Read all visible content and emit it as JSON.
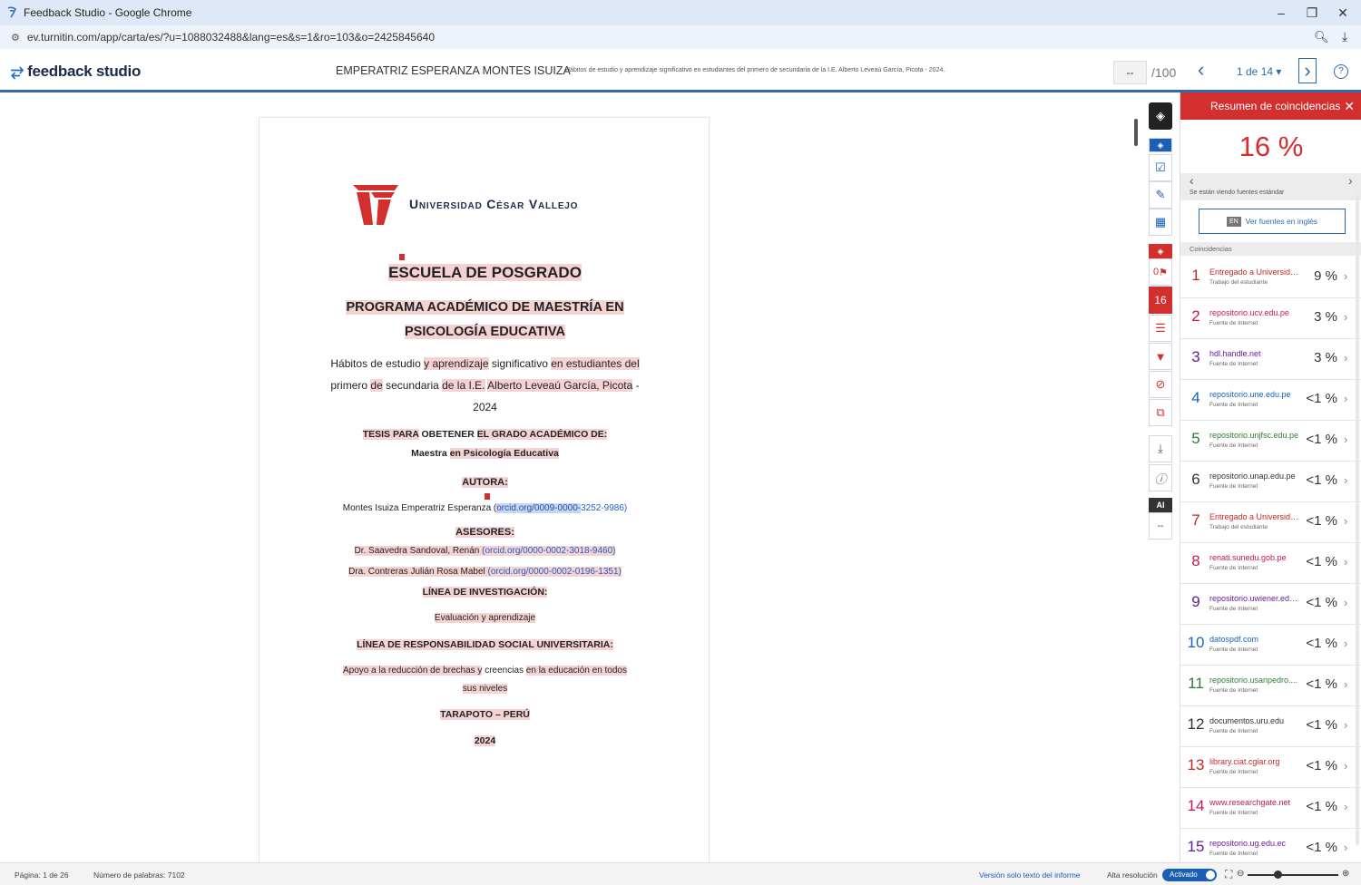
{
  "browser": {
    "window_title": "Feedback Studio - Google Chrome",
    "url": "ev.turnitin.com/app/carta/es/?u=1088032488&lang=es&s=1&ro=103&o=2425845640"
  },
  "header": {
    "brand": "feedback studio",
    "author": "EMPERATRIZ ESPERANZA MONTES ISUIZA",
    "title": "Hábitos de estudio y aprendizaje significativo en estudiantes del primero de secundaria de la I.E. Alberto Leveaú García, Picota - 2024.",
    "score": "--",
    "score_max": "/100",
    "page_indicator": "1 de 14 ▾"
  },
  "document": {
    "university": "Universidad César Vallejo",
    "school": "ESCUELA DE POSGRADO",
    "program_1": "PROGRAMA ACADÉMICO DE MAESTRÍA EN",
    "program_2": "PSICOLOGÍA EDUCATIVA",
    "title_a1": "Hábitos de estudio ",
    "title_a2": "y aprendizaje",
    "title_a3": " significativo ",
    "title_a4": "en estudiantes del",
    "title_b1": "primero ",
    "title_b2": "de",
    "title_b3": " secundaria ",
    "title_b4": "de la I.E.",
    "title_b5": " ",
    "title_b6": "Alberto Leveaú García, Picota",
    "title_b7": " -",
    "title_c": "2024",
    "thesis_1a": "TESIS PARA",
    "thesis_1b": " OBETENER ",
    "thesis_1c": "EL GRADO ACADÉMICO DE:",
    "thesis_2a": "Maestra ",
    "thesis_2b": "en Psicología Educativa",
    "author_label": "AUTORA:",
    "author_name": "Montes Isuiza Emperatriz Esperanza (",
    "author_orcid_a": "orcid.org/0009-0000-",
    "author_orcid_b": "3252-9986)",
    "advisors_label": "ASESORES:",
    "advisor_1": "Dr. Saavedra Sandoval, Renán ",
    "advisor_1_orcid": "(orcid.org/0000-0002-3018-9460)",
    "advisor_2": "Dra. Contreras Julián Rosa Mabel ",
    "advisor_2_orcid": "(orcid.org/0000-0002-0196-1351)",
    "research_label": "LÍNEA DE INVESTIGACIÓN:",
    "research_value": "Evaluación y aprendizaje",
    "rsu_label": "LÍNEA DE RESPONSABILIDAD SOCIAL UNIVERSITARIA:",
    "rsu_1a": "Apoyo a la reducción de brechas y",
    "rsu_1b": " creencias ",
    "rsu_1c": "en la educación en todos",
    "rsu_2": "sus niveles",
    "place": "TARAPOTO – PERÚ",
    "year": "2024"
  },
  "rail": {
    "flag_count": "0",
    "match_count": "16",
    "ai_label": "AI",
    "ai_value": "--"
  },
  "panel": {
    "heading": "Resumen de coincidencias",
    "similarity": "16 %",
    "viewing_note": "Se están viendo fuentes estándar",
    "english_badge": "EN",
    "english_button": "Ver fuentes en inglés",
    "matches_heading": "Coincidencias",
    "matches": [
      {
        "n": "1",
        "source": "Entregado a Universida...",
        "type": "Trabajo del estudiante",
        "pct": "9 %",
        "color": "#c62828"
      },
      {
        "n": "2",
        "source": "repositorio.ucv.edu.pe",
        "type": "Fuente de Internet",
        "pct": "3 %",
        "color": "#c2185b"
      },
      {
        "n": "3",
        "source": "hdl.handle.net",
        "type": "Fuente de Internet",
        "pct": "3 %",
        "color": "#6a1b9a"
      },
      {
        "n": "4",
        "source": "repositorio.une.edu.pe",
        "type": "Fuente de Internet",
        "pct": "<1 %",
        "color": "#1565c0"
      },
      {
        "n": "5",
        "source": "repositorio.unjfsc.edu.pe",
        "type": "Fuente de Internet",
        "pct": "<1 %",
        "color": "#2e7d32"
      },
      {
        "n": "6",
        "source": "repositorio.unap.edu.pe",
        "type": "Fuente de Internet",
        "pct": "<1 %",
        "color": "#333333"
      },
      {
        "n": "7",
        "source": "Entregado a Universida...",
        "type": "Trabajo del estudiante",
        "pct": "<1 %",
        "color": "#c62828"
      },
      {
        "n": "8",
        "source": "renati.sunedu.gob.pe",
        "type": "Fuente de Internet",
        "pct": "<1 %",
        "color": "#c2185b"
      },
      {
        "n": "9",
        "source": "repositorio.uwiener.edu...",
        "type": "Fuente de Internet",
        "pct": "<1 %",
        "color": "#6a1b9a"
      },
      {
        "n": "10",
        "source": "datospdf.com",
        "type": "Fuente de Internet",
        "pct": "<1 %",
        "color": "#1565c0"
      },
      {
        "n": "11",
        "source": "repositorio.usanpedro....",
        "type": "Fuente de Internet",
        "pct": "<1 %",
        "color": "#2e7d32"
      },
      {
        "n": "12",
        "source": "documentos.uru.edu",
        "type": "Fuente de Internet",
        "pct": "<1 %",
        "color": "#333333"
      },
      {
        "n": "13",
        "source": "library.ciat.cgiar.org",
        "type": "Fuente de Internet",
        "pct": "<1 %",
        "color": "#c62828"
      },
      {
        "n": "14",
        "source": "www.researchgate.net",
        "type": "Fuente de Internet",
        "pct": "<1 %",
        "color": "#c2185b"
      },
      {
        "n": "15",
        "source": "repositorio.ug.edu.ec",
        "type": "Fuente de Internet",
        "pct": "<1 %",
        "color": "#6a1b9a"
      }
    ]
  },
  "status": {
    "page": "Página: 1 de 26",
    "words": "Número de palabras: 7102",
    "text_only": "Versión solo texto del informe",
    "hires_label": "Alta resolución",
    "hires_state": "Activado"
  }
}
